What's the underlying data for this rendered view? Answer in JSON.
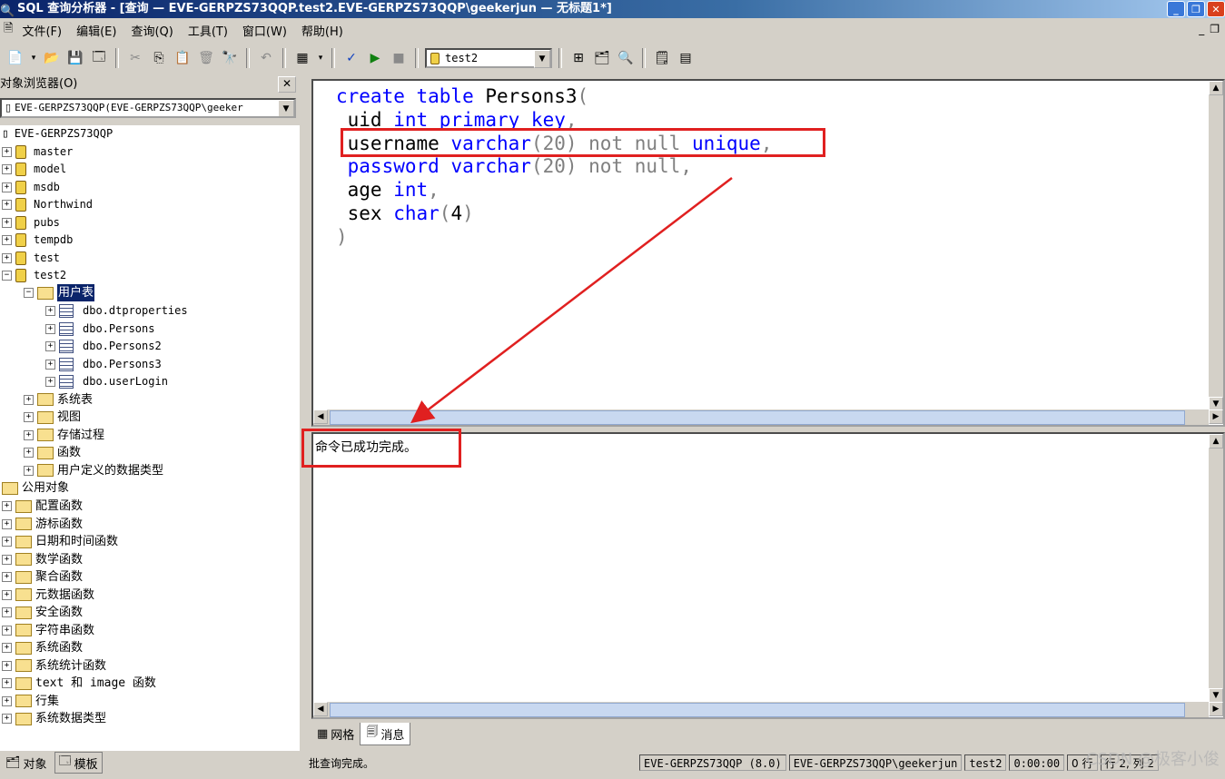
{
  "window": {
    "title": "SQL 查询分析器 - [查询 — EVE-GERPZS73QQP.test2.EVE-GERPZS73QQP\\geekerjun — 无标题1*]"
  },
  "menu": [
    "文件(F)",
    "编辑(E)",
    "查询(Q)",
    "工具(T)",
    "窗口(W)",
    "帮助(H)"
  ],
  "toolbar": {
    "database": "test2"
  },
  "object_browser": {
    "title": "对象浏览器(O)",
    "server_select": "EVE-GERPZS73QQP(EVE-GERPZS73QQP\\geeker",
    "server": "EVE-GERPZS73QQP",
    "databases": [
      "master",
      "model",
      "msdb",
      "Northwind",
      "pubs",
      "tempdb",
      "test",
      "test2"
    ],
    "user_tables_label": "用户表",
    "tables": [
      "dbo.dtproperties",
      "dbo.Persons",
      "dbo.Persons2",
      "dbo.Persons3",
      "dbo.userLogin"
    ],
    "test2_folders": [
      "系统表",
      "视图",
      "存储过程",
      "函数",
      "用户定义的数据类型"
    ],
    "common_objects": "公用对象",
    "common_folders": [
      "配置函数",
      "游标函数",
      "日期和时间函数",
      "数学函数",
      "聚合函数",
      "元数据函数",
      "安全函数",
      "字符串函数",
      "系统函数",
      "系统统计函数",
      "text 和 image 函数",
      "行集",
      "系统数据类型"
    ],
    "tab_objects": "对象",
    "tab_templates": "模板"
  },
  "editor": {
    "lines": [
      [
        [
          "create table",
          "kw"
        ],
        [
          " Persons3",
          ""
        ],
        [
          "(",
          "gray"
        ]
      ],
      [
        [
          " uid ",
          ""
        ],
        [
          "int primary key",
          "kw"
        ],
        [
          ",",
          "gray"
        ]
      ],
      [
        [
          " username ",
          ""
        ],
        [
          "varchar",
          "kw"
        ],
        [
          "(20) not null ",
          "gray"
        ],
        [
          "unique",
          "kw"
        ],
        [
          ",",
          "gray"
        ]
      ],
      [
        [
          " password ",
          "kw"
        ],
        [
          "varchar",
          "kw"
        ],
        [
          "(20) not null,",
          "gray"
        ]
      ],
      [
        [
          " age ",
          ""
        ],
        [
          "int",
          "kw"
        ],
        [
          ",",
          "gray"
        ]
      ],
      [
        [
          " sex ",
          ""
        ],
        [
          "char",
          "kw"
        ],
        [
          "(",
          "gray"
        ],
        [
          "4",
          ""
        ],
        [
          ")",
          "gray"
        ]
      ],
      [
        [
          ")",
          "gray"
        ]
      ]
    ]
  },
  "results": {
    "message": "命令已成功完成。",
    "tab_grid": "网格",
    "tab_messages": "消息"
  },
  "status": {
    "text": "批查询完成。",
    "server": "EVE-GERPZS73QQP (8.0)",
    "user": "EVE-GERPZS73QQP\\geekerjun",
    "db": "test2",
    "time": "0:00:00",
    "rows": "0 行",
    "position": "行 2, 列 2"
  },
  "watermark": "CSDN @极客小俊",
  "colors": {
    "annotation": "#e02020",
    "keyword": "#0000ff",
    "titlebar": "#0a246a"
  }
}
